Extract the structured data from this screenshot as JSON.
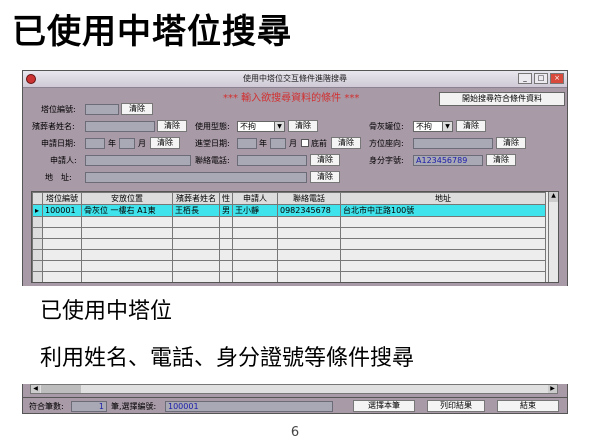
{
  "slide": {
    "title": "已使用中塔位搜尋",
    "caption_line1": "已使用中塔位",
    "caption_line2": "利用姓名、電話、身分證號等條件搜尋",
    "page_number": "6"
  },
  "window": {
    "title": "使用中塔位交互條件進階搜尋",
    "minimize": "_",
    "maximize": "□",
    "close": "×"
  },
  "form": {
    "banner": "***  輸入欲搜尋資料的條件  ***",
    "start_button": "開始搜尋符合條件資料",
    "clear": "清除",
    "tower_no_label": "塔位編號:",
    "deceased_name_label": "殯葬者姓名:",
    "apply_date_label": "申請日期:",
    "year": "年",
    "month": "月",
    "use_type_label": "使用型態:",
    "use_type_value": "不拘",
    "enter_date_label": "進堂日期:",
    "before_label": "底前",
    "contact_phone_label": "聯絡電話:",
    "applicant_label": "申請人:",
    "address_label": "地　址:",
    "ash_position_label": "骨灰罐位:",
    "ash_position_value": "不拘",
    "direction_label": "方位座向:",
    "id_label": "身分字號:",
    "id_value": "A123456789"
  },
  "table": {
    "columns": [
      "塔位編號",
      "安放位置",
      "殯葬者姓名",
      "性",
      "申請人",
      "聯絡電話",
      "地址"
    ],
    "rows": [
      [
        "100001",
        "骨灰位 一樓右 A1東",
        "王栢長",
        "男",
        "王小靜",
        "0982345678",
        "台北市中正路100號"
      ]
    ]
  },
  "status": {
    "count_label": "符合筆數:",
    "count_value": "1",
    "selected_label": "筆,選擇編號:",
    "selected_value": "100001",
    "select_button": "選擇本筆",
    "print_button": "列印結果",
    "end_button": "結束"
  }
}
